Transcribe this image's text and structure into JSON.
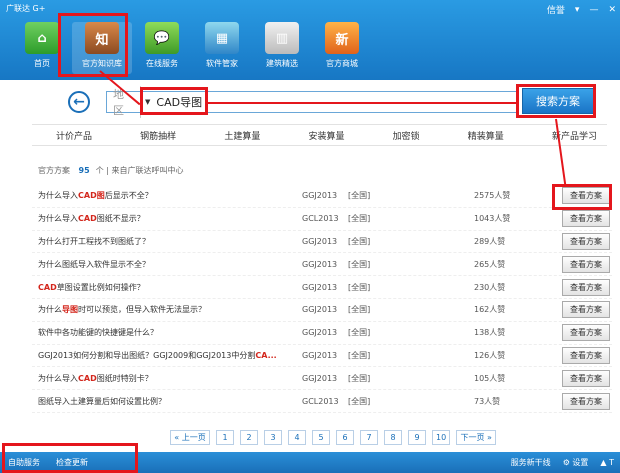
{
  "app": {
    "title": "广联达 G+"
  },
  "window": {
    "user": "信誉",
    "controls": [
      "▾",
      "—",
      "✕"
    ]
  },
  "nav": [
    {
      "label": "首页",
      "icon": "home-icon",
      "glyph": "⌂"
    },
    {
      "label": "官方知识库",
      "icon": "knowledge-book-icon",
      "glyph": "知"
    },
    {
      "label": "在线服务",
      "icon": "chat-service-icon",
      "glyph": "💬"
    },
    {
      "label": "软件管家",
      "icon": "software-manager-icon",
      "glyph": "▦"
    },
    {
      "label": "建筑精选",
      "icon": "building-books-icon",
      "glyph": "▥"
    },
    {
      "label": "官方商城",
      "icon": "shopping-mall-icon",
      "glyph": "新"
    }
  ],
  "search": {
    "region_placeholder": "地区",
    "query": "CAD导图",
    "button": "搜索方案",
    "back_glyph": "←"
  },
  "categories": [
    "计价产品",
    "钢筋抽样",
    "土建算量",
    "安装算量",
    "加密锁",
    "精装算量",
    "新产品学习"
  ],
  "result_header": {
    "label": "官方方案",
    "count": "95",
    "unit": "个",
    "source": "来自广联达呼叫中心"
  },
  "results": [
    {
      "parts": [
        "为什么导入",
        "CAD图",
        "后显示不全？"
      ],
      "version": "GGJ2013",
      "scope": "[全国]",
      "likes": "2575人赞",
      "action": "查看方案"
    },
    {
      "parts": [
        "为什么导入",
        "CAD",
        "图纸不显示？"
      ],
      "version": "GCL2013",
      "scope": "[全国]",
      "likes": "1043人赞",
      "action": "查看方案"
    },
    {
      "parts": [
        "为什么打开工程找不到图纸了？",
        "",
        ""
      ],
      "version": "GGJ2013",
      "scope": "[全国]",
      "likes": "289人赞",
      "action": "查看方案"
    },
    {
      "parts": [
        "为什么图纸导入软件显示不全？",
        "",
        ""
      ],
      "version": "GGJ2013",
      "scope": "[全国]",
      "likes": "265人赞",
      "action": "查看方案"
    },
    {
      "parts": [
        "",
        "CAD",
        "草图设置比例如何操作？"
      ],
      "version": "GGJ2013",
      "scope": "[全国]",
      "likes": "230人赞",
      "action": "查看方案"
    },
    {
      "parts": [
        "为什么",
        "导图",
        "时可以预览，但导入软件无法显示？"
      ],
      "version": "GGJ2013",
      "scope": "[全国]",
      "likes": "162人赞",
      "action": "查看方案"
    },
    {
      "parts": [
        "软件中各功能键的快捷键是什么？",
        "",
        ""
      ],
      "version": "GGJ2013",
      "scope": "[全国]",
      "likes": "138人赞",
      "action": "查看方案"
    },
    {
      "parts": [
        "GGJ2013如何分割和导出图纸？GGJ2009和GGJ2013中分割",
        "CA...",
        ""
      ],
      "version": "GGJ2013",
      "scope": "[全国]",
      "likes": "126人赞",
      "action": "查看方案"
    },
    {
      "parts": [
        "为什么导入",
        "CAD",
        "图纸时特别卡？"
      ],
      "version": "GGJ2013",
      "scope": "[全国]",
      "likes": "105人赞",
      "action": "查看方案"
    },
    {
      "parts": [
        "图纸导入土建算量后如何设置比例？",
        "",
        ""
      ],
      "version": "GCL2013",
      "scope": "[全国]",
      "likes": "73人赞",
      "action": "查看方案"
    }
  ],
  "pager": {
    "prev": "« 上一页",
    "pages": [
      "1",
      "2",
      "3",
      "4",
      "5",
      "6",
      "7",
      "8",
      "9",
      "10"
    ],
    "next": "下一页 »"
  },
  "status": {
    "left": [
      "自助服务",
      "检查更新"
    ],
    "right": [
      "服务新干线",
      "⚙ 设置",
      "▲ T"
    ]
  }
}
